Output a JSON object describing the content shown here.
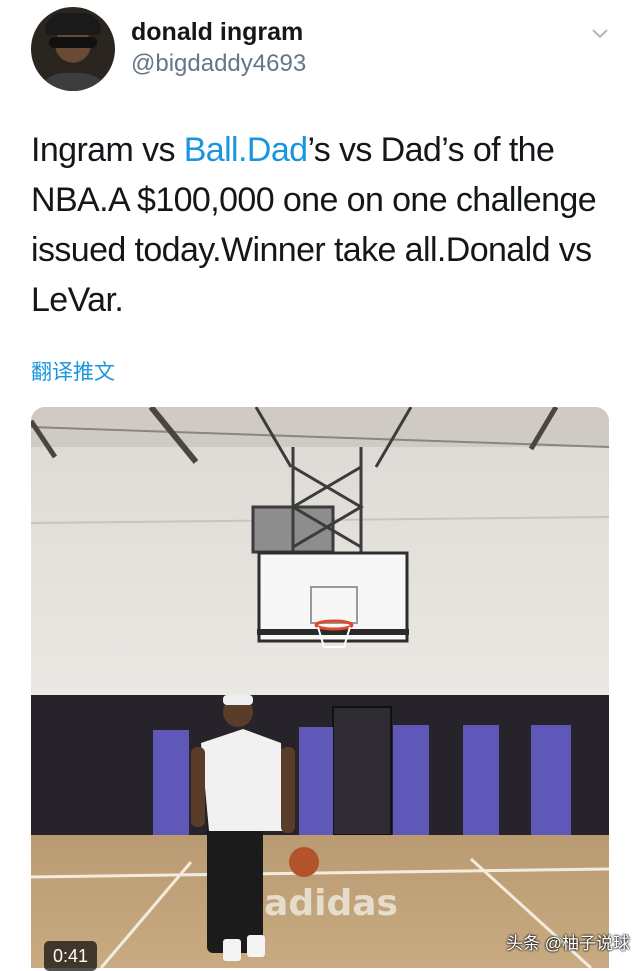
{
  "author": {
    "name": "donald ingram",
    "handle": "@bigdaddy4693"
  },
  "tweet": {
    "text_before": "Ingram vs ",
    "link": "Ball.Dad",
    "text_after": "’s vs Dad’s of the NBA.A $100,000 one on one challenge issued today.Winner take all.Donald vs LeVar.",
    "translate_label": "翻译推文"
  },
  "media": {
    "duration": "0:41",
    "court_logo": "adidas"
  },
  "watermark": "头条 @柚子说球",
  "icons": {
    "menu": "chevron-down-icon",
    "avatar": "profile-photo"
  },
  "colors": {
    "link": "#1b95e0",
    "secondary_text": "#657786",
    "primary_text": "#14171a"
  }
}
